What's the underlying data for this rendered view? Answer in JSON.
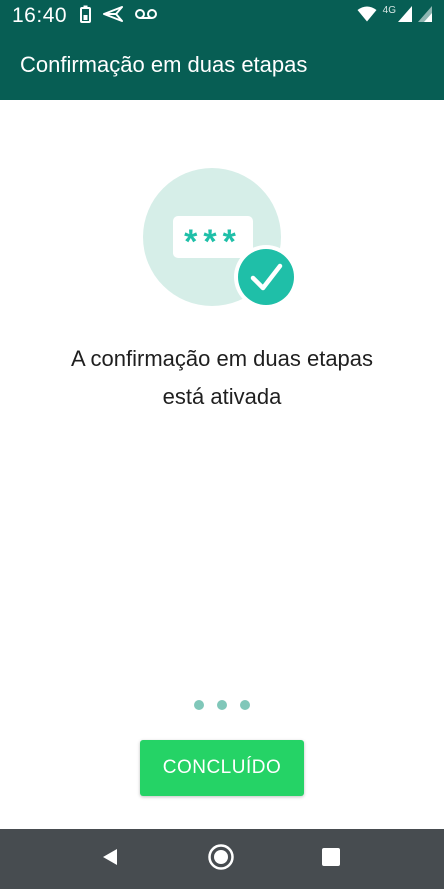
{
  "colors": {
    "primary_dark": "#075E54",
    "accent_green": "#25D366",
    "teal_icon": "#1fbfa8",
    "illustration_circle": "#d6eee8",
    "pager_dot": "#80c7b9",
    "nav_bar": "#474c50"
  },
  "status_bar": {
    "time": "16:40",
    "network_label": "4G",
    "icons": [
      "battery-saver-icon",
      "send-icon",
      "voicemail-icon",
      "wifi-icon",
      "signal-icon",
      "signal-icon-secondary"
    ]
  },
  "app_bar": {
    "title": "Confirmação em duas etapas"
  },
  "main": {
    "illustration": {
      "password_mask": "***",
      "icon": "check-icon"
    },
    "message_line_1": "A confirmação em duas etapas",
    "message_line_2": "está ativada",
    "pager": {
      "count": 3
    },
    "done_button_label": "CONCLUÍDO"
  },
  "nav_bar": {
    "icons": [
      "back-icon",
      "home-icon",
      "recents-icon"
    ]
  }
}
